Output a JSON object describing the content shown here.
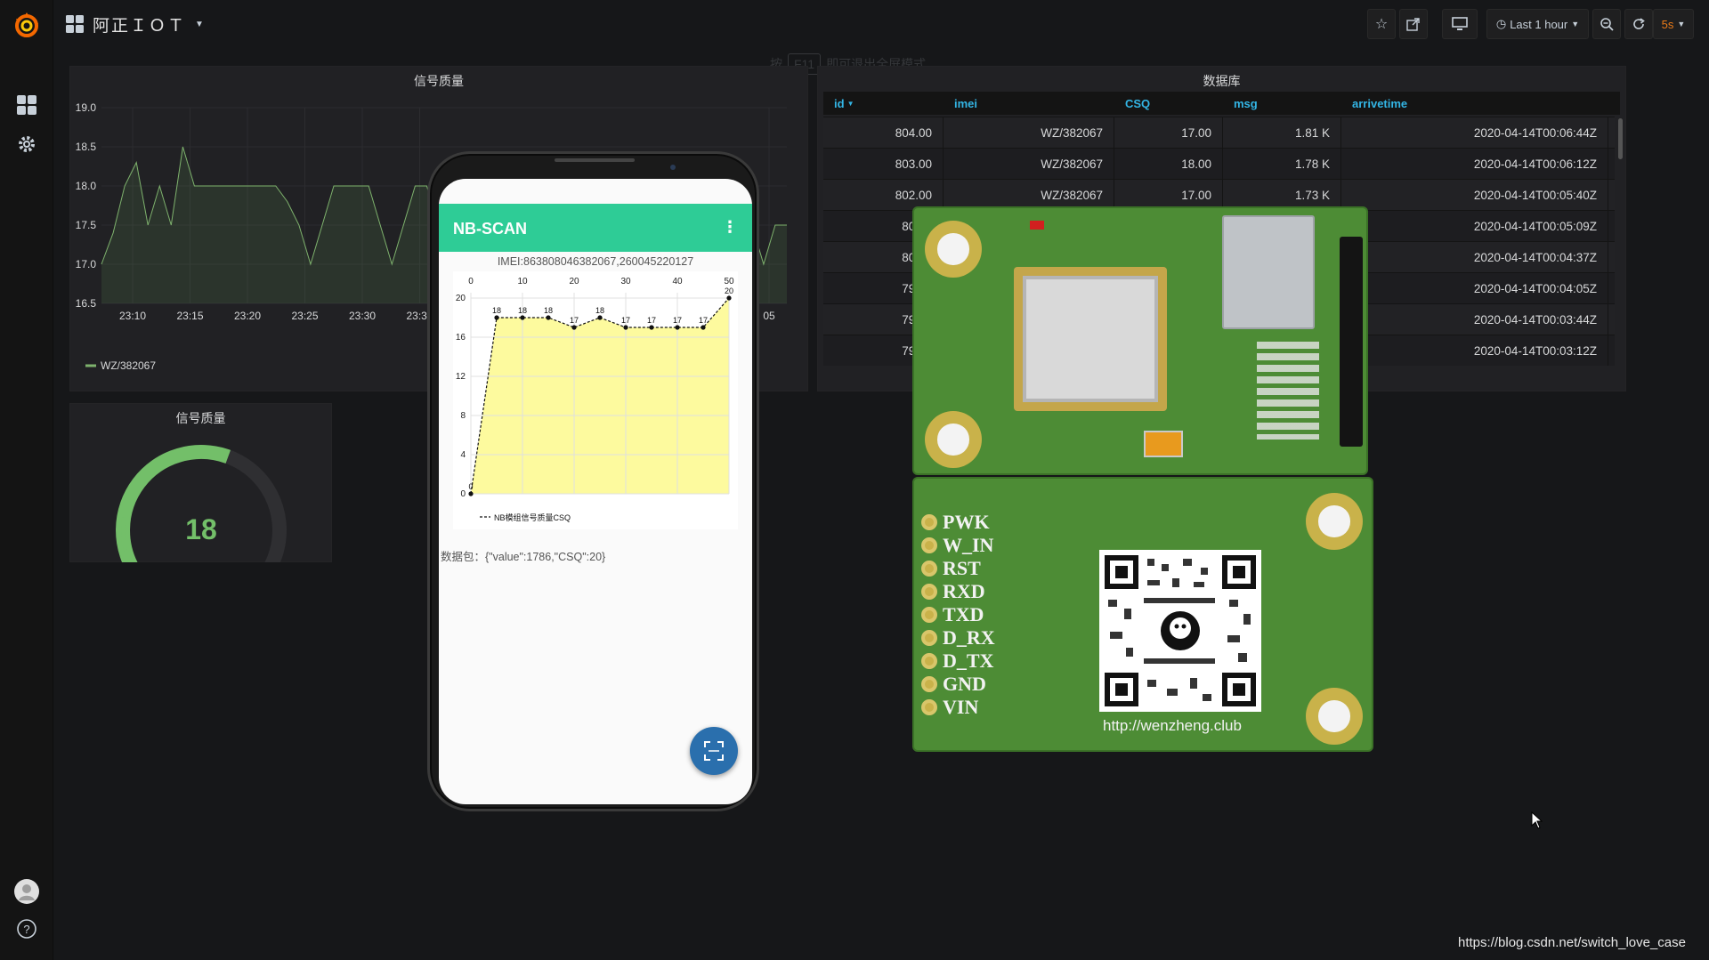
{
  "navbar": {
    "title": "阿正ＩＯＴ",
    "time_range": "Last 1 hour",
    "refresh_interval": "5s"
  },
  "hint": {
    "prefix": "按",
    "key": "F11",
    "suffix": "即可退出全屏模式"
  },
  "graph_panel": {
    "title": "信号质量",
    "legend": "WZ/382067",
    "chart_data": {
      "type": "area",
      "title": "信号质量",
      "xlabel": "",
      "ylabel": "",
      "ylim": [
        16.5,
        19.0
      ],
      "y_ticks": [
        "19.0",
        "18.5",
        "18.0",
        "17.5",
        "17.0",
        "16.5"
      ],
      "x_ticks": [
        "23:10",
        "23:15",
        "23:20",
        "23:25",
        "23:30",
        "23:35",
        "05"
      ],
      "series": [
        {
          "name": "WZ/382067",
          "x_minutes": [
            0,
            1,
            2,
            3,
            4,
            5,
            6,
            7,
            8,
            9,
            10,
            11,
            12,
            13,
            14,
            15,
            16,
            17,
            18,
            19,
            20,
            21,
            22,
            23,
            24,
            25,
            26,
            27,
            28,
            29,
            30,
            31,
            32,
            33,
            34,
            35,
            36,
            37,
            38,
            39,
            40,
            41,
            42,
            43,
            44,
            45,
            46,
            47,
            48,
            49,
            50,
            51,
            52,
            53,
            54,
            55,
            56,
            57,
            58,
            59
          ],
          "values": [
            17,
            17.4,
            18,
            18.3,
            17.5,
            18,
            17.5,
            18.5,
            18,
            18,
            18,
            18,
            18,
            18,
            18,
            18,
            17.8,
            17.5,
            17,
            17.5,
            18,
            18,
            18,
            18,
            17.5,
            17,
            17.5,
            18,
            18,
            17.5,
            17,
            17,
            18,
            18,
            18,
            18,
            18,
            18,
            18,
            18,
            18,
            18,
            18,
            18,
            18,
            18,
            18,
            18,
            18,
            18,
            18,
            18,
            18,
            18,
            18,
            18,
            17.5,
            17,
            17.5,
            17.5
          ]
        }
      ]
    }
  },
  "gauge_panel": {
    "title": "信号质量",
    "value": "18",
    "fraction": 0.58,
    "color": "#73bf69"
  },
  "table_panel": {
    "title": "数据库",
    "columns": [
      "id",
      "imei",
      "CSQ",
      "msg",
      "arrivetime"
    ],
    "rows": [
      [
        "804.00",
        "WZ/382067",
        "17.00",
        "1.81 K",
        "2020-04-14T00:06:44Z"
      ],
      [
        "803.00",
        "WZ/382067",
        "18.00",
        "1.78 K",
        "2020-04-14T00:06:12Z"
      ],
      [
        "802.00",
        "WZ/382067",
        "17.00",
        "1.73 K",
        "2020-04-14T00:05:40Z"
      ],
      [
        "801.0",
        "",
        "",
        "",
        "2020-04-14T00:05:09Z"
      ],
      [
        "800.0",
        "",
        "",
        "",
        "2020-04-14T00:04:37Z"
      ],
      [
        "799.0",
        "",
        "",
        "",
        "2020-04-14T00:04:05Z"
      ],
      [
        "798.0",
        "",
        "",
        "",
        "2020-04-14T00:03:44Z"
      ],
      [
        "797.0",
        "",
        "",
        "",
        "2020-04-14T00:03:12Z"
      ]
    ]
  },
  "phone": {
    "app_title": "NB-SCAN",
    "imei_line": "IMEI:863808046382067,260045220127",
    "packet_line": "数据包：{\"value\":1786,\"CSQ\":20}",
    "chart_data": {
      "type": "area",
      "title": "",
      "legend": "NB模组信号质量CSQ",
      "x_ticks": [
        "0",
        "10",
        "20",
        "30",
        "40",
        "50"
      ],
      "y_ticks": [
        "20",
        "16",
        "12",
        "8",
        "4",
        "0"
      ],
      "xlim": [
        0,
        50
      ],
      "ylim": [
        0,
        20
      ],
      "x": [
        0,
        5,
        10,
        15,
        20,
        25,
        30,
        35,
        40,
        45,
        50
      ],
      "values": [
        0,
        18,
        18,
        18,
        17,
        18,
        17,
        17,
        17,
        17,
        20
      ],
      "fill_color": "#fdfa9e"
    }
  },
  "pcb": {
    "pins": [
      "PWK",
      "W_IN",
      "RST",
      "RXD",
      "TXD",
      "D_RX",
      "D_TX",
      "GND",
      "VIN"
    ],
    "url": "http://wenzheng.club"
  },
  "watermark": "https://blog.csdn.net/switch_love_case"
}
